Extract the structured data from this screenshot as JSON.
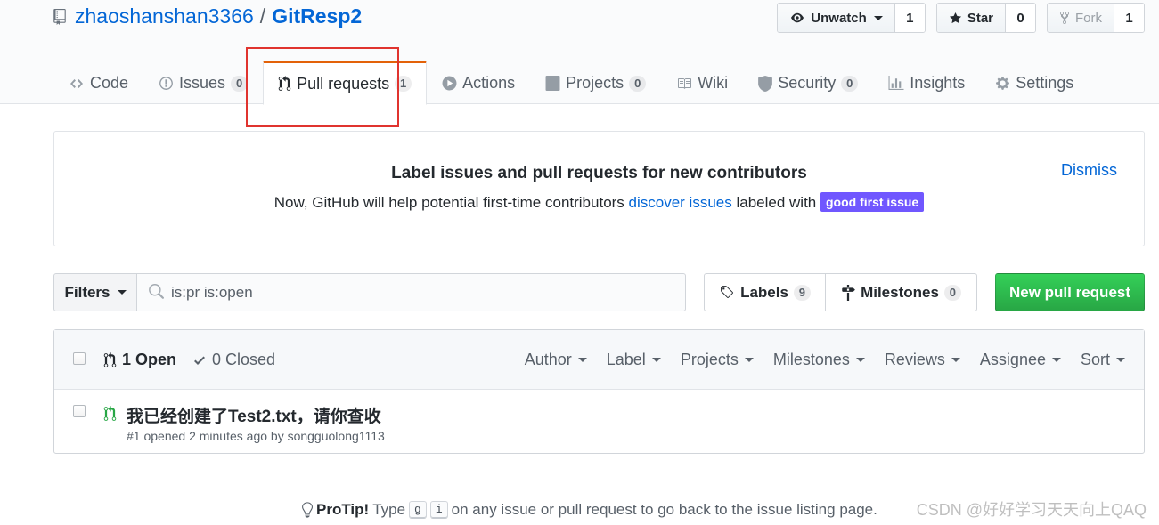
{
  "repo": {
    "owner": "zhaoshanshan3366",
    "separator": "/",
    "name": "GitResp2"
  },
  "actions": {
    "watch": {
      "label": "Unwatch",
      "count": "1"
    },
    "star": {
      "label": "Star",
      "count": "0"
    },
    "fork": {
      "label": "Fork",
      "count": "1"
    }
  },
  "nav": {
    "code": "Code",
    "issues": {
      "label": "Issues",
      "count": "0"
    },
    "pulls": {
      "label": "Pull requests",
      "count": "1"
    },
    "actions": "Actions",
    "projects": {
      "label": "Projects",
      "count": "0"
    },
    "wiki": "Wiki",
    "security": {
      "label": "Security",
      "count": "0"
    },
    "insights": "Insights",
    "settings": "Settings"
  },
  "banner": {
    "title": "Label issues and pull requests for new contributors",
    "text_before": "Now, GitHub will help potential first-time contributors ",
    "link": "discover issues",
    "text_after": " labeled with ",
    "label": "good first issue",
    "label_color": "#7057ff",
    "dismiss": "Dismiss"
  },
  "toolbar": {
    "filters": "Filters",
    "search_value": "is:pr is:open",
    "labels": {
      "label": "Labels",
      "count": "9"
    },
    "milestones": {
      "label": "Milestones",
      "count": "0"
    },
    "new_pr": "New pull request"
  },
  "list": {
    "open": "1 Open",
    "closed": "0 Closed",
    "filters": [
      "Author",
      "Label",
      "Projects",
      "Milestones",
      "Reviews",
      "Assignee",
      "Sort"
    ],
    "items": [
      {
        "title": "我已经创建了Test2.txt，请你查收",
        "meta": "#1 opened 2 minutes ago by songguolong1113"
      }
    ]
  },
  "protip": {
    "strong": "ProTip!",
    "before": "Type",
    "key1": "g",
    "key2": "i",
    "after": "on any issue or pull request to go back to the issue listing page."
  },
  "watermark": "CSDN @好好学习天天向上QAQ",
  "colors": {
    "accent": "#0366d6",
    "selected_tab": "#e36209",
    "green": "#28a745",
    "highlight": "#e0342f"
  }
}
